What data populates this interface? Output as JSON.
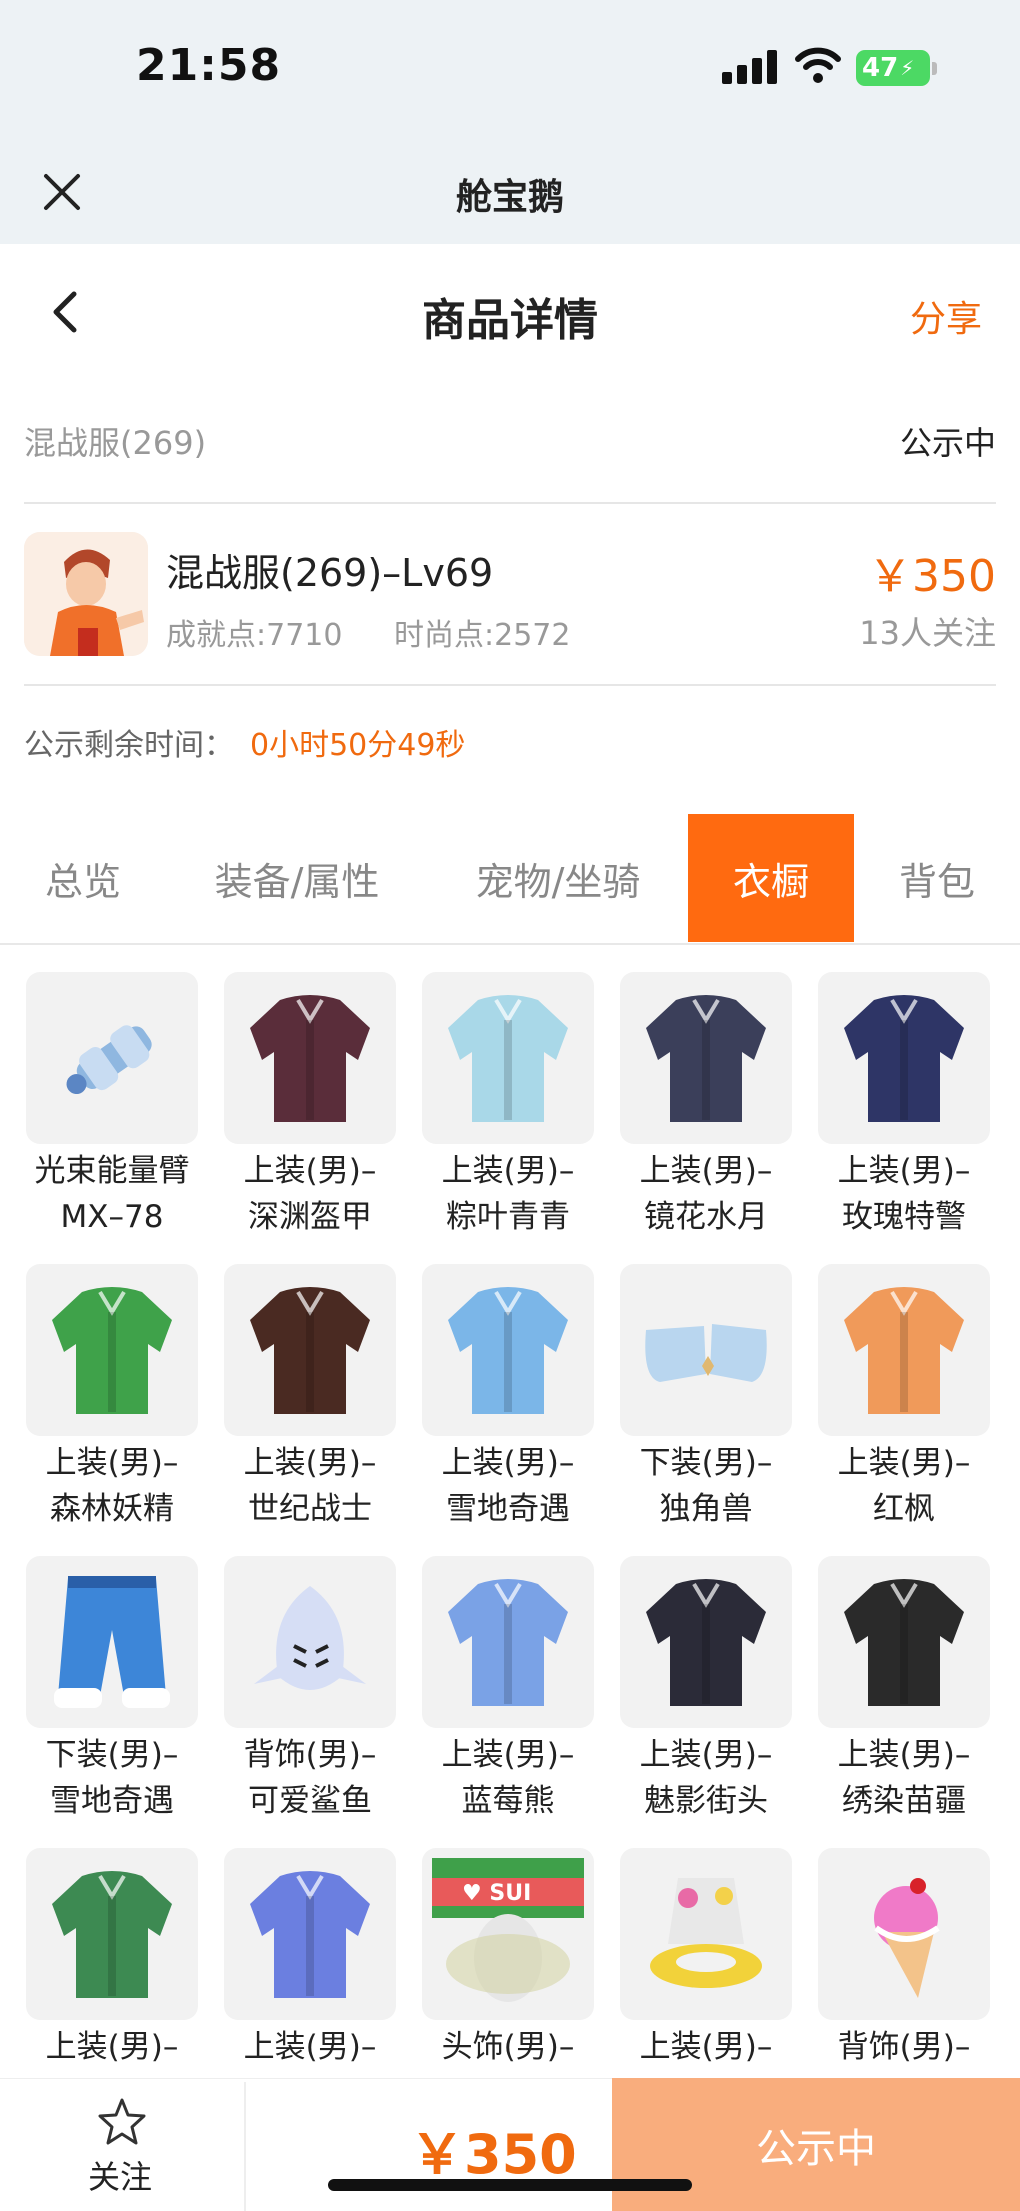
{
  "status_bar": {
    "time": "21:58",
    "battery": "47"
  },
  "app_bar": {
    "title": "舱宝鹅"
  },
  "nav": {
    "title": "商品详情",
    "share": "分享"
  },
  "listing": {
    "server": "混战服(269)",
    "status": "公示中",
    "name": "混战服(269)–Lv69",
    "achievement": "成就点:7710",
    "fashion": "时尚点:2572",
    "price": "￥350",
    "followers": "13人关注",
    "countdown_label": "公示剩余时间：",
    "countdown_value": "0小时50分49秒"
  },
  "tabs": [
    {
      "label": "总览"
    },
    {
      "label": "装备/属性"
    },
    {
      "label": "宠物/坐骑"
    },
    {
      "label": "衣橱"
    },
    {
      "label": "背包"
    }
  ],
  "active_tab": "衣橱",
  "wardrobe": [
    {
      "line1": "光束能量臂",
      "line2": "MX–78",
      "icon": "energy-arm-icon",
      "color": "#8fb7e0"
    },
    {
      "line1": "上装(男)–",
      "line2": "深渊盔甲",
      "icon": "armor-icon",
      "color": "#5a2d3a"
    },
    {
      "line1": "上装(男)–",
      "line2": "粽叶青青",
      "icon": "robe-icon",
      "color": "#a9d8e8"
    },
    {
      "line1": "上装(男)–",
      "line2": "镜花水月",
      "icon": "jacket-icon",
      "color": "#3b3f5a"
    },
    {
      "line1": "上装(男)–",
      "line2": "玫瑰特警",
      "icon": "uniform-icon",
      "color": "#2e3566"
    },
    {
      "line1": "上装(男)–",
      "line2": "森林妖精",
      "icon": "leaf-outfit-icon",
      "color": "#3fa24a"
    },
    {
      "line1": "上装(男)–",
      "line2": "世纪战士",
      "icon": "coat-icon",
      "color": "#4a2a22"
    },
    {
      "line1": "上装(男)–",
      "line2": "雪地奇遇",
      "icon": "snow-jacket-icon",
      "color": "#7bb6e8"
    },
    {
      "line1": "下装(男)–",
      "line2": "独角兽",
      "icon": "boots-icon",
      "color": "#b9d6ef"
    },
    {
      "line1": "上装(男)–",
      "line2": "红枫",
      "icon": "maple-robe-icon",
      "color": "#f09a5a"
    },
    {
      "line1": "下装(男)–",
      "line2": "雪地奇遇",
      "icon": "pants-icon",
      "color": "#3d86d8"
    },
    {
      "line1": "背饰(男)–",
      "line2": "可爱鲨鱼",
      "icon": "shark-icon",
      "color": "#d6def5"
    },
    {
      "line1": "上装(男)–",
      "line2": "蓝莓熊",
      "icon": "bear-jacket-icon",
      "color": "#7aa2e6"
    },
    {
      "line1": "上装(男)–",
      "line2": "魅影街头",
      "icon": "street-jacket-icon",
      "color": "#2b2b38"
    },
    {
      "line1": "上装(男)–",
      "line2": "绣染苗疆",
      "icon": "embroidered-icon",
      "color": "#2a2a2a"
    },
    {
      "line1": "上装(男)–",
      "line2": "",
      "icon": "vest-icon",
      "color": "#3d8a52"
    },
    {
      "line1": "上装(男)–",
      "line2": "",
      "icon": "graffiti-jacket-icon",
      "color": "#6b7fe0"
    },
    {
      "line1": "头饰(男)–",
      "line2": "",
      "icon": "hat-icon",
      "color": "#e85a5a"
    },
    {
      "line1": "上装(男)–",
      "line2": "",
      "icon": "floatie-icon",
      "color": "#f2d23a"
    },
    {
      "line1": "背饰(男)–",
      "line2": "",
      "icon": "icecream-icon",
      "color": "#f07ac8"
    }
  ],
  "bottom": {
    "follow": "关注",
    "price": "￥350",
    "status_button": "公示中"
  }
}
